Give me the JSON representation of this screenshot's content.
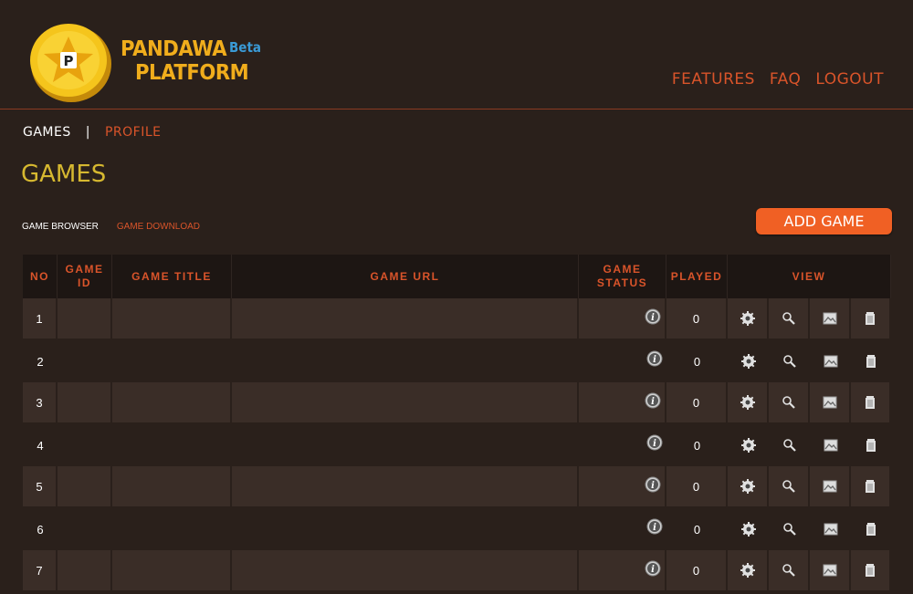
{
  "brand": {
    "line1": "PANDAWA",
    "beta": "Beta",
    "line2": "PLATFORM"
  },
  "topnav": [
    {
      "label": "FEATURES"
    },
    {
      "label": "FAQ"
    },
    {
      "label": "LOGOUT"
    }
  ],
  "subnav": {
    "active": "GAMES",
    "separator": "|",
    "profile": "PROFILE"
  },
  "page_title": "GAMES",
  "tabs": {
    "browser": "GAME BROWSER",
    "download": "GAME DOWNLOAD"
  },
  "add_button": "ADD GAME",
  "table": {
    "headers": {
      "no": "NO",
      "game_id": "GAME ID",
      "game_title": "GAME TITLE",
      "game_url": "GAME URL",
      "game_status": "GAME STATUS",
      "played": "PLAYED",
      "view": "VIEW"
    },
    "rows": [
      {
        "no": "1",
        "played": "0"
      },
      {
        "no": "2",
        "played": "0"
      },
      {
        "no": "3",
        "played": "0"
      },
      {
        "no": "4",
        "played": "0"
      },
      {
        "no": "5",
        "played": "0"
      },
      {
        "no": "6",
        "played": "0"
      },
      {
        "no": "7",
        "played": "0"
      }
    ]
  },
  "icons": [
    "info-icon",
    "gear-icon",
    "magnifier-icon",
    "image-icon",
    "trash-icon"
  ],
  "colors": {
    "accent": "#d9542a",
    "title": "#d6b830",
    "button": "#f06024",
    "background": "#2a201b"
  }
}
